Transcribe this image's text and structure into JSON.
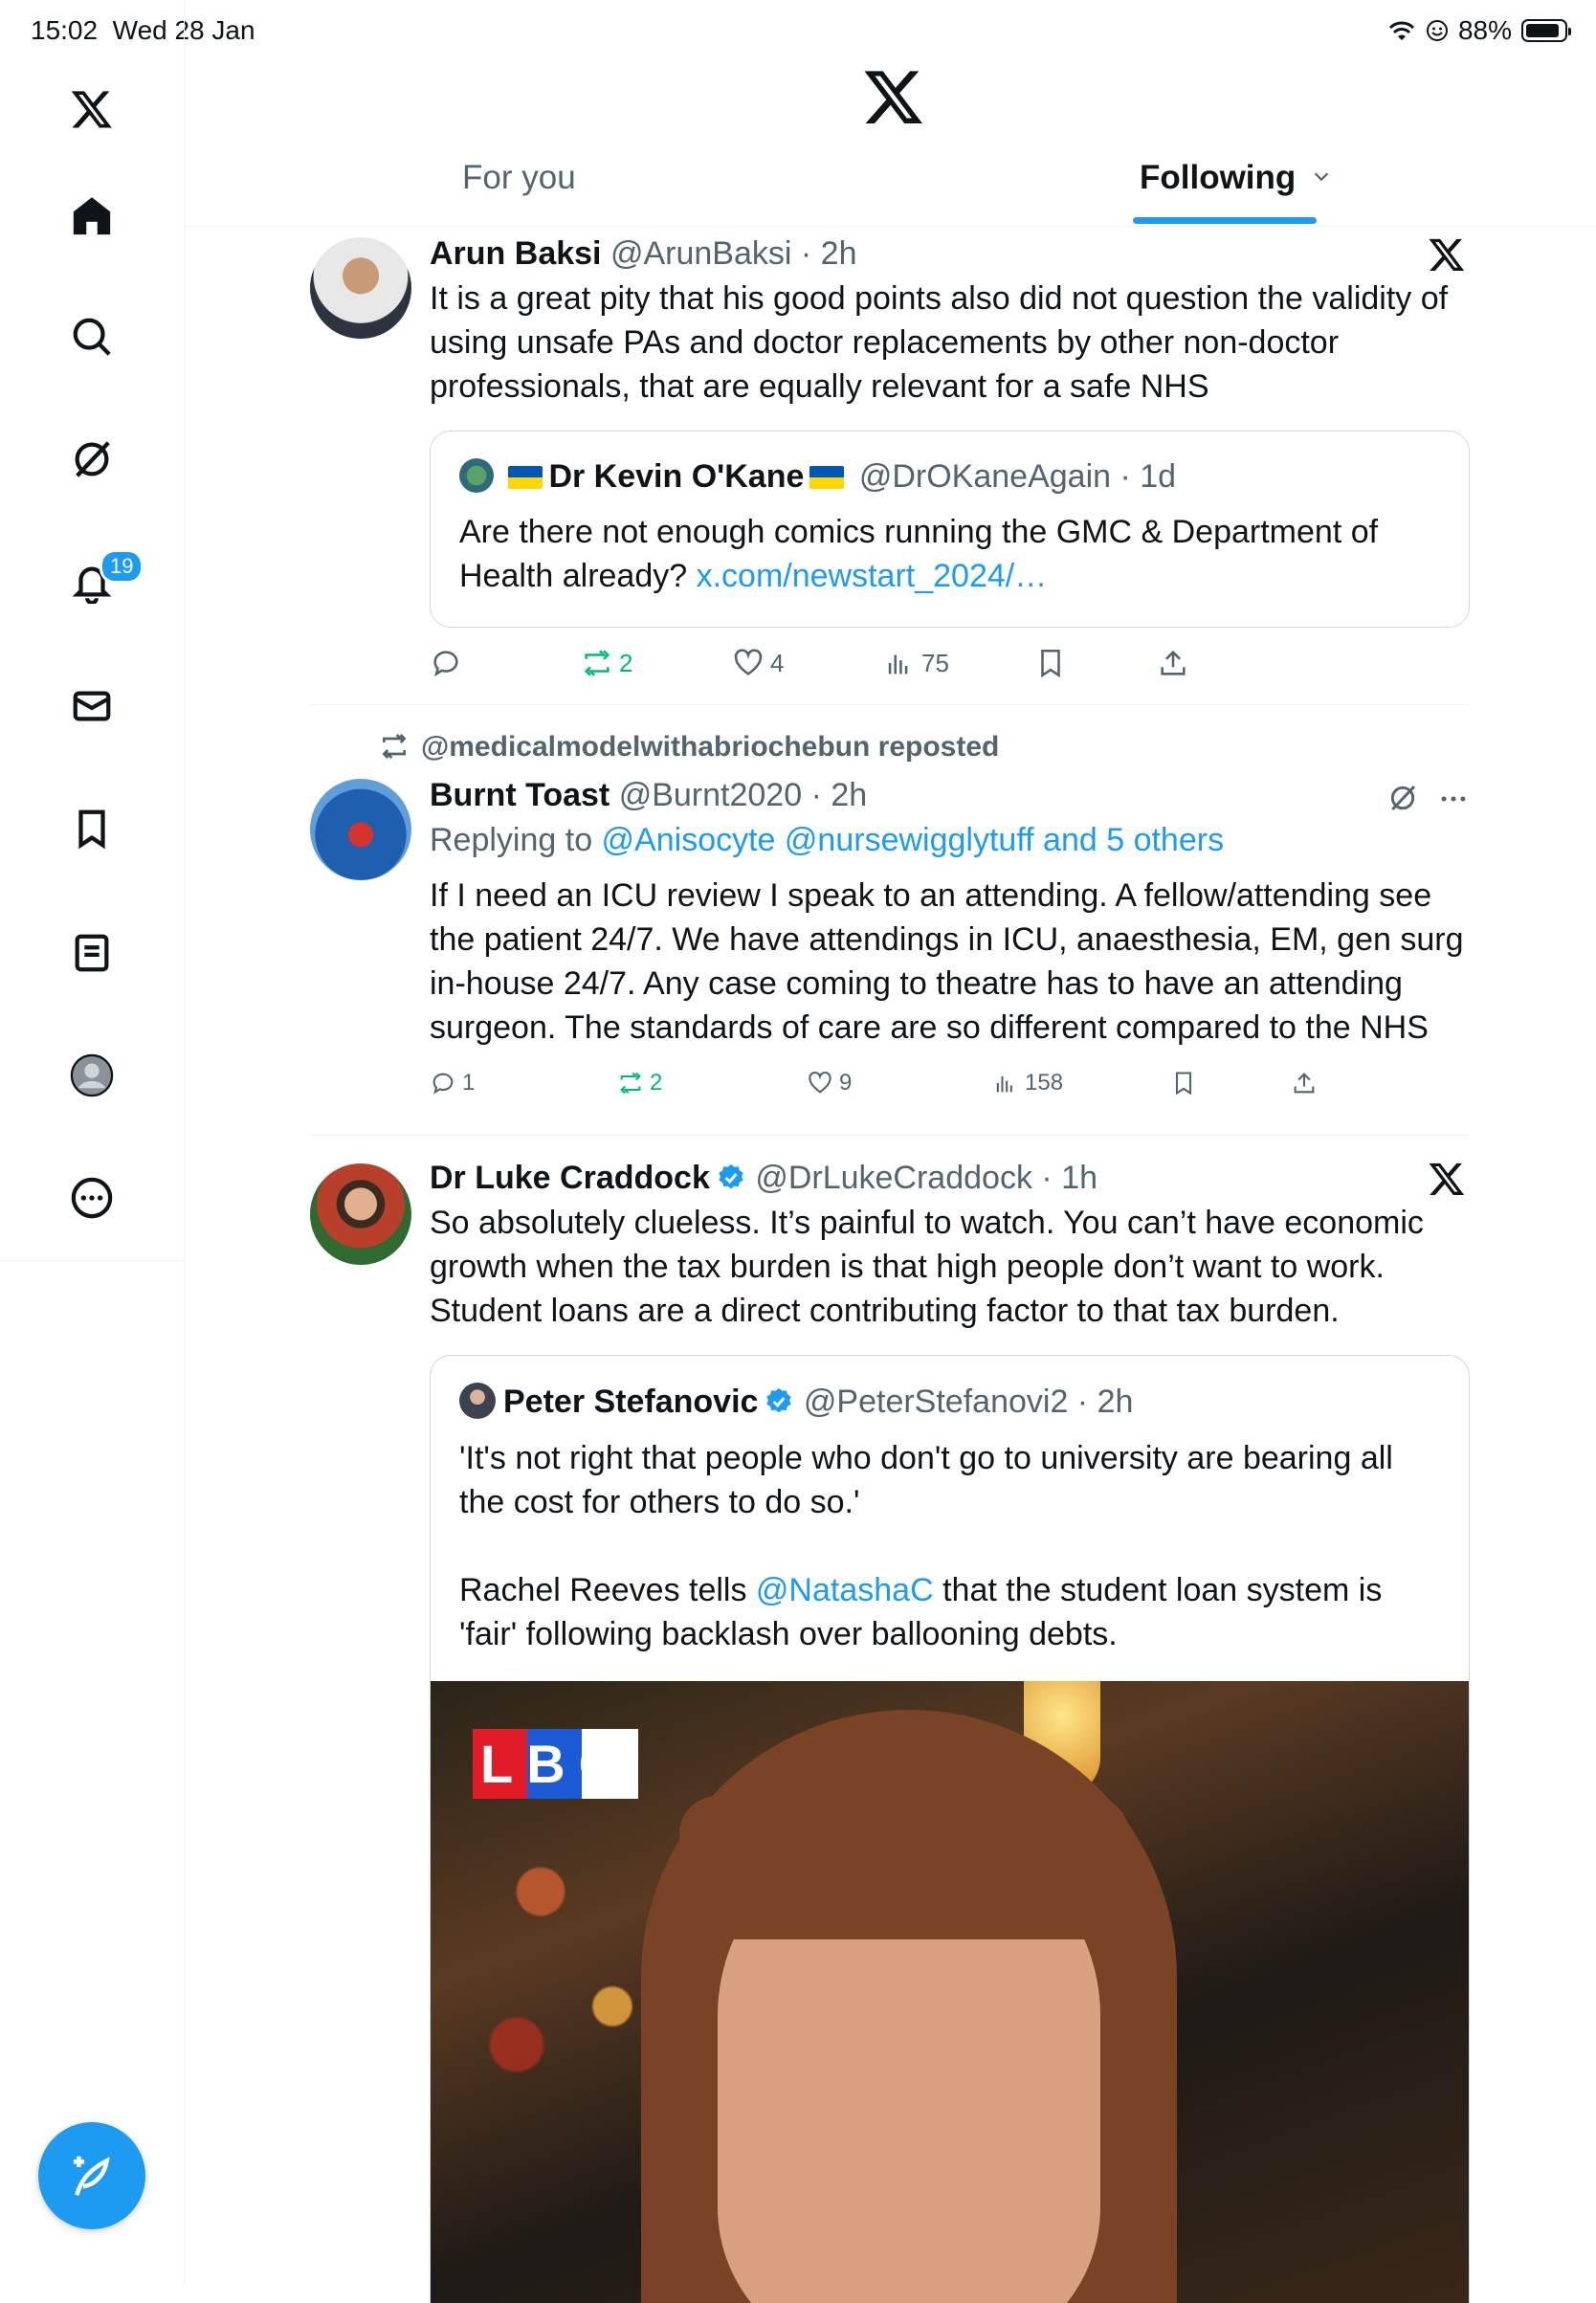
{
  "status_bar": {
    "time": "15:02",
    "date": "Wed 28 Jan",
    "battery": "88%",
    "battery_fraction": 0.88
  },
  "sidebar": {
    "items": [
      {
        "name": "home",
        "icon": "home-icon"
      },
      {
        "name": "explore",
        "icon": "search-icon"
      },
      {
        "name": "grok",
        "icon": "grok-icon"
      },
      {
        "name": "notifications",
        "icon": "bell-icon",
        "badge": "19"
      },
      {
        "name": "messages",
        "icon": "mail-icon"
      },
      {
        "name": "bookmarks",
        "icon": "bookmark-icon"
      },
      {
        "name": "lists",
        "icon": "list-icon"
      },
      {
        "name": "profile",
        "icon": "avatar-icon"
      },
      {
        "name": "more",
        "icon": "more-icon"
      }
    ],
    "compose": "compose-icon"
  },
  "header": {
    "tabs": [
      {
        "label": "For you",
        "active": false
      },
      {
        "label": "Following",
        "active": true
      }
    ]
  },
  "feed": [
    {
      "name": "Arun Baksi",
      "handle": "@ArunBaksi",
      "time": "2h",
      "text": "It is a great pity that his good points also did not question the validity of using unsafe PAs and doctor replacements by other non-doctor professionals, that are equally relevant for a safe NHS",
      "quote": {
        "name": "Dr Kevin O'Kane",
        "handle": "@DrOKaneAgain",
        "time": "1d",
        "text": "Are there not enough comics running the GMC & Department of Health already? ",
        "link": "x.com/newstart_2024/…"
      },
      "actions": {
        "replies": "",
        "reposts": "2",
        "likes": "4",
        "views": "75"
      }
    },
    {
      "repost_by": "@medicalmodelwithabriochebun reposted",
      "name": "Burnt Toast",
      "handle": "@Burnt2020",
      "time": "2h",
      "replying_prefix": "Replying to ",
      "replying_to": "@Anisocyte @nursewigglytuff and 5 others",
      "text": "If I need an ICU review I speak to an attending. A fellow/attending see the patient 24/7. We have attendings in ICU, anaesthesia, EM, gen surg in-house 24/7. Any case coming to theatre has to have an attending surgeon. The standards of care are so different compared to the NHS",
      "actions": {
        "replies": "1",
        "reposts": "2",
        "likes": "9",
        "views": "158"
      }
    },
    {
      "name": "Dr Luke Craddock",
      "handle": "@DrLukeCraddock",
      "time": "1h",
      "text": "So absolutely clueless. It’s painful to watch. You can’t have economic growth when the tax burden is that high people don’t want to work. Student loans are a direct contributing factor to that tax burden.",
      "quote": {
        "name": "Peter Stefanovic",
        "handle": "@PeterStefanovi2",
        "time": "2h",
        "text1": "'It's not right that people who don't go to university are bearing all the cost for others to do so.'",
        "text2_prefix": "Rachel Reeves tells ",
        "text2_link": "@NatashaC",
        "text2_suffix": " that the student loan system is 'fair' following backlash over ballooning debts.",
        "media_logo": "LBC"
      }
    }
  ],
  "colors": {
    "accent": "#1d9bf0",
    "text": "#0f1419",
    "muted": "#536471",
    "repost": "#00ba7c",
    "border": "#cfd9de"
  }
}
